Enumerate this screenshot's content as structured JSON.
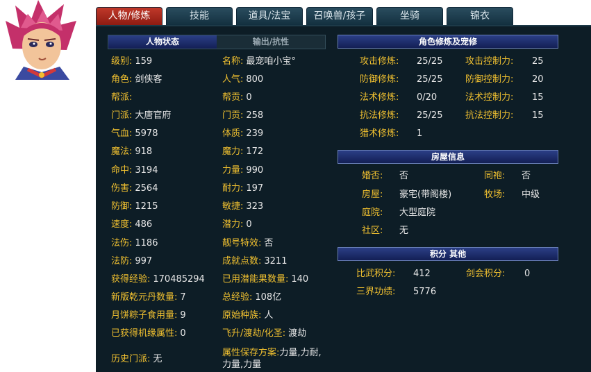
{
  "tabs": [
    "人物/修炼",
    "技能",
    "道具/法宝",
    "召唤兽/孩子",
    "坐骑",
    "锦衣"
  ],
  "status_tabs": {
    "active": "人物状态",
    "inactive": "输出/抗性"
  },
  "stats_left": [
    {
      "label": "级别:",
      "value": "159"
    },
    {
      "label": "角色:",
      "value": "剑侠客"
    },
    {
      "label": "帮派:",
      "value": ""
    },
    {
      "label": "门派:",
      "value": "大唐官府"
    },
    {
      "label": "气血:",
      "value": "5978"
    },
    {
      "label": "魔法:",
      "value": "918"
    },
    {
      "label": "命中:",
      "value": "3194"
    },
    {
      "label": "伤害:",
      "value": "2564"
    },
    {
      "label": "防御:",
      "value": "1215"
    },
    {
      "label": "速度:",
      "value": "486"
    },
    {
      "label": "法伤:",
      "value": "1186"
    },
    {
      "label": "法防:",
      "value": "997"
    },
    {
      "label": "获得经验:",
      "value": "170485294"
    },
    {
      "label": "新版乾元丹数量:",
      "value": "7"
    },
    {
      "label": "月饼粽子食用量:",
      "value": "9"
    },
    {
      "label": "已获得机缘属性:",
      "value": "0"
    },
    {
      "label": "历史门派:",
      "value": "无"
    }
  ],
  "stats_right": [
    {
      "label": "名称:",
      "value": "最宠咱小宝°"
    },
    {
      "label": "人气:",
      "value": "800"
    },
    {
      "label": "帮贡:",
      "value": "0"
    },
    {
      "label": "门贡:",
      "value": "258"
    },
    {
      "label": "体质:",
      "value": "239"
    },
    {
      "label": "魔力:",
      "value": "172"
    },
    {
      "label": "力量:",
      "value": "990"
    },
    {
      "label": "耐力:",
      "value": "197"
    },
    {
      "label": "敏捷:",
      "value": "323"
    },
    {
      "label": "潜力:",
      "value": "0"
    },
    {
      "label": "靓号特效:",
      "value": "否"
    },
    {
      "label": "成就点数:",
      "value": "3211"
    },
    {
      "label": "已用潜能果数量:",
      "value": "140"
    },
    {
      "label": "总经验:",
      "value": "108亿"
    },
    {
      "label": "原始种族:",
      "value": "人"
    },
    {
      "label": "飞升/渡劫/化圣:",
      "value": "渡劫"
    },
    {
      "label": "属性保存方案:",
      "value": "力量,力耐,力量,力量"
    }
  ],
  "cultivation": {
    "title": "角色修炼及宠修",
    "rows": [
      {
        "l1": "攻击修炼:",
        "v1": "25/25",
        "l2": "攻击控制力:",
        "v2": "25"
      },
      {
        "l1": "防御修炼:",
        "v1": "25/25",
        "l2": "防御控制力:",
        "v2": "20"
      },
      {
        "l1": "法术修炼:",
        "v1": "0/20",
        "l2": "法术控制力:",
        "v2": "15"
      },
      {
        "l1": "抗法修炼:",
        "v1": "25/25",
        "l2": "抗法控制力:",
        "v2": "15"
      },
      {
        "l1": "猎术修炼:",
        "v1": "1",
        "l2": "",
        "v2": ""
      }
    ]
  },
  "house": {
    "title": "房屋信息",
    "rows": [
      {
        "l1": "婚否:",
        "v1": "否",
        "l2": "同袍:",
        "v2": "否"
      },
      {
        "l1": "房屋:",
        "v1": "豪宅(带阁楼)",
        "l2": "牧场:",
        "v2": "中级"
      },
      {
        "l1": "庭院:",
        "v1": "大型庭院",
        "l2": "",
        "v2": ""
      },
      {
        "l1": "社区:",
        "v1": "无",
        "l2": "",
        "v2": ""
      }
    ]
  },
  "points": {
    "title": "积分 其他",
    "rows": [
      {
        "l1": "比武积分:",
        "v1": "412",
        "l2": "剑会积分:",
        "v2": "0"
      },
      {
        "l1": "三界功绩:",
        "v1": "5776",
        "l2": "",
        "v2": ""
      }
    ]
  },
  "colors": {
    "label": "#f0c030",
    "value": "#e8e8e8",
    "panel": "#0d1d26",
    "header": "#1f2f70",
    "active_tab": "#a52a1e"
  },
  "icons": {
    "avatar": "character-portrait"
  }
}
